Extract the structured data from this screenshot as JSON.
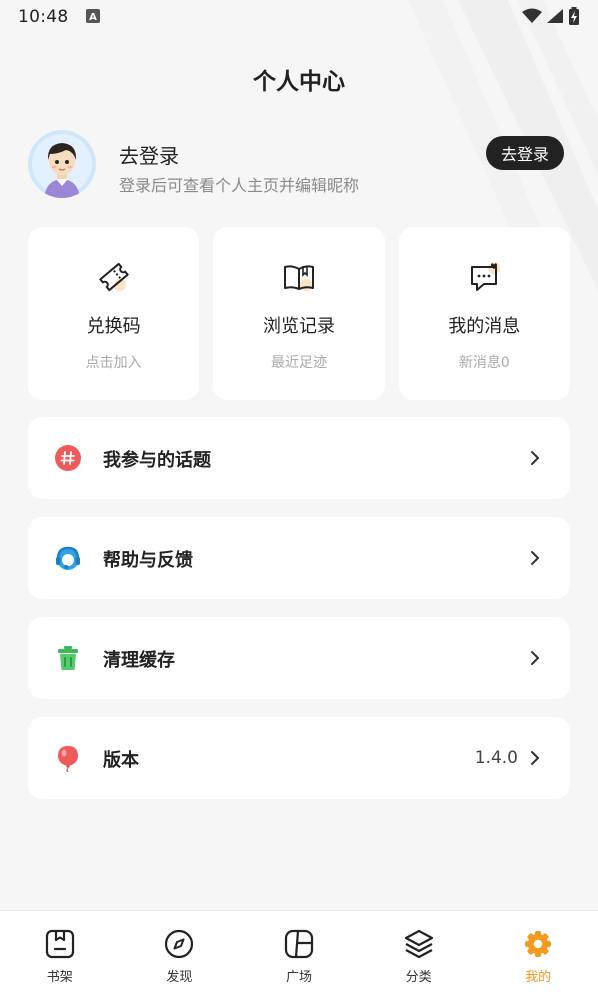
{
  "status_bar": {
    "time": "10:48",
    "notification_glyph": "A"
  },
  "header": {
    "title": "个人中心"
  },
  "profile": {
    "name": "去登录",
    "subtitle": "登录后可查看个人主页并编辑昵称",
    "login_button": "去登录"
  },
  "cards": [
    {
      "label": "兑换码",
      "sub": "点击加入",
      "icon": "ticket-icon"
    },
    {
      "label": "浏览记录",
      "sub": "最近足迹",
      "icon": "book-icon"
    },
    {
      "label": "我的消息",
      "sub": "新消息0",
      "icon": "message-icon"
    }
  ],
  "menu": [
    {
      "label": "我参与的话题",
      "icon": "hashtag-icon",
      "value": ""
    },
    {
      "label": "帮助与反馈",
      "icon": "headset-icon",
      "value": ""
    },
    {
      "label": "清理缓存",
      "icon": "trash-icon",
      "value": ""
    },
    {
      "label": "版本",
      "icon": "balloon-icon",
      "value": "1.4.0"
    }
  ],
  "tabs": [
    {
      "label": "书架",
      "icon": "bookshelf-icon",
      "active": false
    },
    {
      "label": "发现",
      "icon": "compass-icon",
      "active": false
    },
    {
      "label": "广场",
      "icon": "square-icon",
      "active": false
    },
    {
      "label": "分类",
      "icon": "layers-icon",
      "active": false
    },
    {
      "label": "我的",
      "icon": "gear-icon",
      "active": true
    }
  ],
  "colors": {
    "accent": "#f39a1f",
    "background": "#f6f6f6",
    "card": "#ffffff",
    "button_dark": "#222222"
  }
}
